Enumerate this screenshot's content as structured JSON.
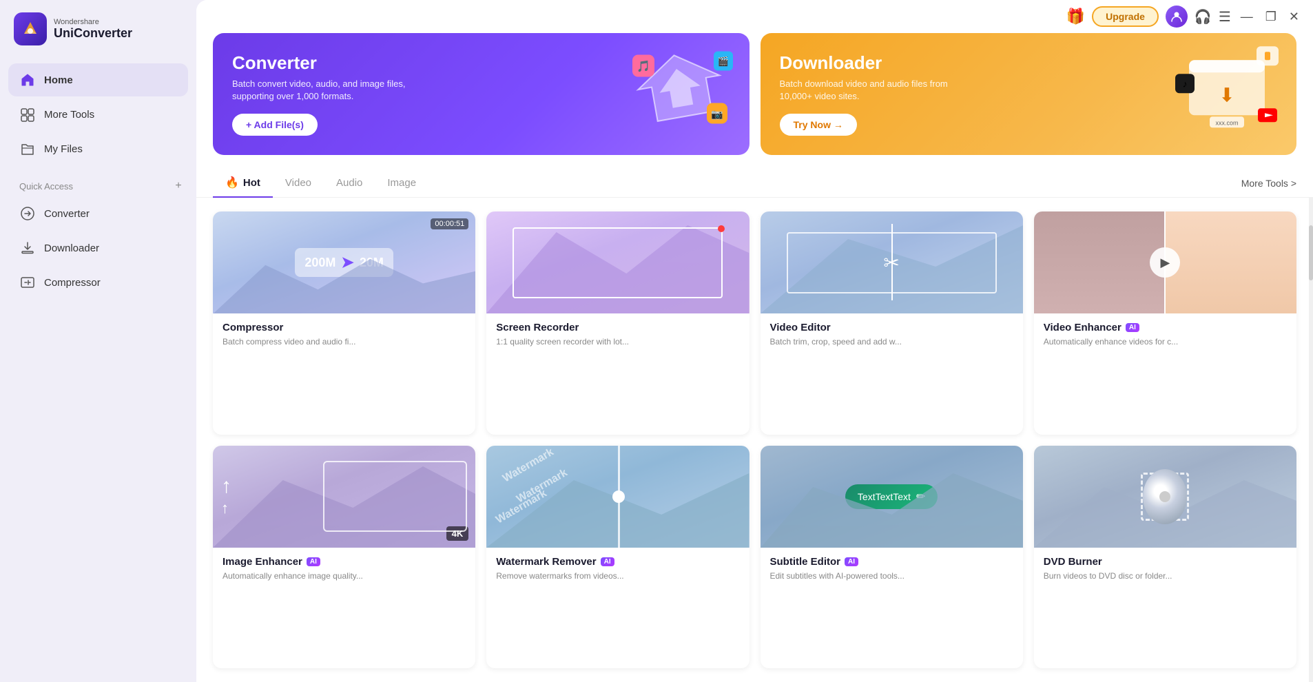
{
  "app": {
    "brand": "Wondershare",
    "product": "UniConverter"
  },
  "titlebar": {
    "upgrade_label": "Upgrade",
    "gift_icon": "🎁",
    "headphone_icon": "🎧",
    "menu_icon": "☰",
    "minimize_icon": "—",
    "maximize_icon": "❐",
    "close_icon": "✕"
  },
  "sidebar": {
    "nav_items": [
      {
        "id": "home",
        "label": "Home",
        "active": true
      },
      {
        "id": "more-tools",
        "label": "More Tools",
        "active": false
      },
      {
        "id": "my-files",
        "label": "My Files",
        "active": false
      }
    ],
    "section_title": "Quick Access",
    "quick_access": [
      {
        "id": "converter",
        "label": "Converter"
      },
      {
        "id": "downloader",
        "label": "Downloader"
      },
      {
        "id": "compressor",
        "label": "Compressor"
      }
    ]
  },
  "hero": {
    "converter": {
      "title": "Converter",
      "desc": "Batch convert video, audio, and image files, supporting over 1,000 formats.",
      "btn_label": "+ Add File(s)"
    },
    "downloader": {
      "title": "Downloader",
      "desc": "Batch download video and audio files from 10,000+ video sites.",
      "btn_label": "Try Now →"
    }
  },
  "tabs": {
    "items": [
      {
        "id": "hot",
        "label": "Hot",
        "active": true,
        "icon": "🔥"
      },
      {
        "id": "video",
        "label": "Video",
        "active": false
      },
      {
        "id": "audio",
        "label": "Audio",
        "active": false
      },
      {
        "id": "image",
        "label": "Image",
        "active": false
      }
    ],
    "more_tools_link": "More Tools >"
  },
  "tools": [
    {
      "id": "compressor",
      "title": "Compressor",
      "desc": "Batch compress video and audio fi...",
      "ai": false,
      "time_badge": "00:00:51",
      "thumb_type": "compressor",
      "compress_from": "200M",
      "compress_to": "20M"
    },
    {
      "id": "screen-recorder",
      "title": "Screen Recorder",
      "desc": "1:1 quality screen recorder with lot...",
      "ai": false,
      "thumb_type": "screen-recorder"
    },
    {
      "id": "video-editor",
      "title": "Video Editor",
      "desc": "Batch trim, crop, speed and add w...",
      "ai": false,
      "thumb_type": "video-editor"
    },
    {
      "id": "video-enhancer",
      "title": "Video Enhancer",
      "desc": "Automatically enhance videos for c...",
      "ai": true,
      "thumb_type": "video-enhancer"
    },
    {
      "id": "image-enhancer",
      "title": "Image Enhancer",
      "desc": "Automatically enhance image quality...",
      "ai": true,
      "thumb_type": "image-enhancer",
      "badge_4k": "4K"
    },
    {
      "id": "watermark-remover",
      "title": "Watermark Remover",
      "desc": "Remove watermarks from videos...",
      "ai": true,
      "thumb_type": "watermark"
    },
    {
      "id": "subtitle-editor",
      "title": "Subtitle Editor",
      "desc": "Edit subtitles with AI-powered tools...",
      "ai": true,
      "thumb_type": "subtitle"
    },
    {
      "id": "dvd-burner",
      "title": "DVD Burner",
      "desc": "Burn videos to DVD disc or folder...",
      "ai": false,
      "thumb_type": "dvd"
    }
  ]
}
